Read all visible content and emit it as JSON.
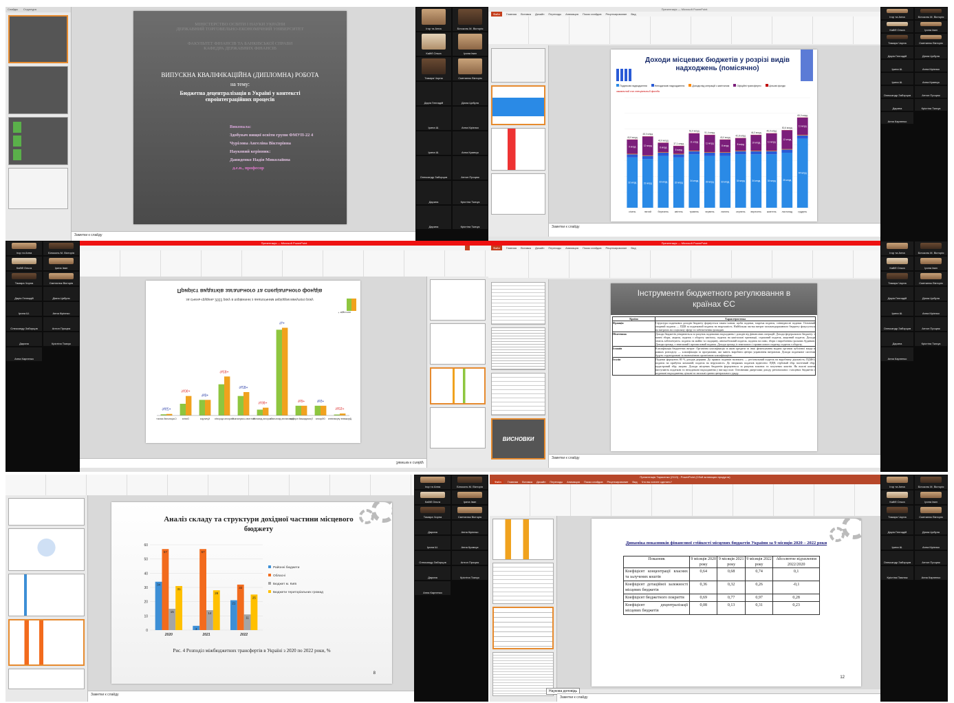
{
  "p1": {
    "tabs": [
      "Слайды",
      "Структура"
    ],
    "notes": "Заметки к слайду",
    "slide": {
      "ministry": "МІНІСТЕРСТВО ОСВІТИ І НАУКИ УКРАЇНИ",
      "univ": "ДЕРЖАВНИЙ ТОРГОВЕЛЬНО-ЕКОНОМІЧНИЙ УНІВЕРСИТЕТ",
      "faculty": "ФАКУЛЬТЕТ ФІНАНСІВ ТА БАНКІВСЬКОЇ СПРАВИ",
      "dept": "КАФЕДРА ДЕРЖАВНИХ ФІНАНСІВ",
      "work": "ВИПУСКНА КВАЛІФІКАЦІЙНА (ДИПЛОМНА) РОБОТА",
      "on_topic": "на тему:",
      "topic": "Бюджетна децентралізація в Україні у контексті євроінтеграційних процесів",
      "done_by": "Виконала:",
      "student_group": "Здобувач вищої освіти групи ФМУП-22 4",
      "student": "Чурілова Ангеліна Вікторівна",
      "supervisor_lbl": "Науковий керівник:",
      "supervisor": "Давиденко Надія Миколаївна",
      "degree": "д.е.н., професор"
    }
  },
  "g1": [
    "Ігор та Анна",
    "Білоконь М. Вікторія",
    "Кайіб Ольга",
    "Ірина Іван",
    "Тамара Чорна",
    "Сметанюк Вікторія",
    "Дарія Геннадій",
    "Діана Цибуля",
    "Ірина Ш.",
    "Анна Кірієнко",
    "Ірина Ш.",
    "Анна Кравчук",
    "Олександр Заборцов",
    "Антон Процюк",
    "Дарина",
    "Крістіна Ткачук",
    "Дарина",
    "Крістіна Ткачук"
  ],
  "p2": {
    "title": "Презентація — Microsoft PowerPoint",
    "tabs": [
      "Файл",
      "Главная",
      "Вставка",
      "Дизайн",
      "Переходы",
      "Анимация",
      "Показ слайдов",
      "Рецензирование",
      "Вид"
    ],
    "notes": "Заметки к слайду",
    "chart_data": {
      "type": "bar",
      "title": "Доходи місцевих бюджетів у розрізі видів надходжень (помісячно)",
      "categories": [
        "січень",
        "лютий",
        "березень",
        "квітень",
        "травень",
        "червень",
        "липень",
        "серпень",
        "вересень",
        "жовтень",
        "листопад",
        "грудень"
      ],
      "series": [
        {
          "name": "Податкові надходження",
          "values": [
            32,
            31,
            33,
            32,
            34,
            33,
            33,
            34,
            34,
            34,
            35,
            44
          ],
          "color": "#2a8ae6"
        },
        {
          "name": "Неподаткові надходження",
          "values": [
            2,
            2,
            2,
            2,
            2,
            2,
            2,
            2,
            2,
            2,
            2,
            2
          ],
          "color": "#2a5bd6"
        },
        {
          "name": "Доходи від операцій з капіталом",
          "values": [
            0.3,
            0.3,
            0.3,
            0.3,
            0.3,
            0.3,
            0.3,
            0.3,
            0.3,
            0.3,
            0.3,
            0.3
          ],
          "color": "#ff8a00"
        },
        {
          "name": "Офіційні трансферти",
          "values": [
            9,
            12,
            6,
            5,
            11,
            11,
            8,
            8,
            10,
            11,
            12,
            11
          ],
          "color": "#7b1e7a"
        },
        {
          "name": "Цільові фонди",
          "values": [
            0.1,
            0.1,
            0.1,
            0.1,
            0.1,
            0.1,
            0.1,
            0.1,
            0.1,
            0.1,
            0.1,
            0.1
          ],
          "color": "#c00000"
        }
      ],
      "totals": [
        "43,9 млрд",
        "48,0 млрд",
        "40,9 млрд",
        "37,1 млрд",
        "51,9 млрд",
        "51,4 млрд",
        "43,0 млрд",
        "42,8 млрд",
        "46,3 млрд",
        "46,9 млрд",
        "50,6 млрд",
        "65,0 млрд"
      ],
      "legend_extra": "загальний та спеціальний фонди",
      "ylim": [
        0,
        70
      ]
    }
  },
  "g2": [
    "Ігор та Анна",
    "Білоконь М. Вікторія",
    "Кайіб Ольга",
    "Ірина Іван",
    "Тамара Чорна",
    "Сметанюк Вікторія",
    "Дарія Геннадій",
    "Діана Цибуля",
    "Ірина Ш.",
    "Анна Кірієнко",
    "Ірина Ш.",
    "Анна Кравчук",
    "Олександр Заборцов",
    "Антон Процюк",
    "Дарина",
    "Крістіна Ткачук",
    "Анна Карпенко"
  ],
  "p3": {
    "title": "Презентація — Microsoft PowerPoint",
    "notes": "Заметки к слайду",
    "chart_data": {
      "type": "bar",
      "title": "Приріст видатків загального та спеціального фондів",
      "subtitle": "за січень-грудень 2022 року в порівнянні з аналогічним періодом минулого року",
      "categories": [
        "Державне управління",
        "Оборона",
        "Громадський порядок",
        "Економічна діяльність",
        "Охорона довкілля",
        "Житлово-комунальне",
        "Охорона здоров'я",
        "Культура",
        "Освіта",
        "Соціальний захист"
      ],
      "series": [
        {
          "name": "загальний фонд",
          "values": [
            1,
            5,
            5,
            45,
            4,
            12,
            20,
            8,
            10,
            0.8
          ],
          "color": "#f0a21e"
        },
        {
          "name": "спеціальний фонд",
          "values": [
            0.5,
            5,
            5,
            44,
            3,
            10,
            16,
            8,
            6,
            0.6
          ],
          "color": "#8ec63f"
        }
      ],
      "labels": [
        "+53%",
        "+5%",
        "+8%",
        "+%",
        "+86%",
        "+82%",
        "+83%",
        "+8%",
        "+90%",
        "+29%"
      ],
      "legend": "+ відсоток"
    }
  },
  "g3": [
    "Ігор та Анна",
    "Білоконь М. Вікторія",
    "Кайіб Ольга",
    "Ірина Іван",
    "Тамара Чорна",
    "Сметанюк Вікторія",
    "Дарія Геннадій",
    "Діана Цибуля",
    "Ірина Ш.",
    "Анна Кірієнко",
    "Олександр Заборцов",
    "Антон Процюк",
    "Дарина",
    "Крістіна Ткачук",
    "Анна Карпенко"
  ],
  "p4": {
    "title": "Презентація — Microsoft PowerPoint",
    "notes": "Заметки к слайду",
    "slide_title": "Інструменти бюджетного регулювання в країнах ЄС",
    "table": {
      "head": [
        "Країна",
        "Характеристика"
      ],
      "rows": [
        [
          "Франція",
          "Структура податкових доходів бюджету формується таким чином, щоби податки, зокрема податок, співвідносні податки. Основний опорний податок — ПДВ за податковий податок на нерухомість. Найбільша частка витрат загальнодержавного бюджету фокусується на витратах на соціальну сферу та забезпечення громадян."
        ],
        [
          "Німеччина",
          "Доходи бюджетів утворюються за рахунок податкових надходжень і доходів від фінансових операцій. Доходи федерального бюджету: з митні збори, акцизи, податок з обороту капіталу, податок на капітальні транзакції, страховий податок, акцизний податок. Доходи земель забезпечують: податок на майно та спадщину, автомобільний податок, податок на пиво, збори з вироблення гральних будинків. Доходи громад: з земельний і промисловий податок. Доходи громад із земельного і промислового податку, податок з обороту."
        ],
        [
          "Іспанія",
          "Класифікація бюджетних витрат: Органічна класифікація за якою кредити та інші фінансування видано органам публічної влади в рамках розподілу. — класифікація за програмами, які мають виробити центри управління витратами. Доходи податкової системи будуть структуровані за економічною органічною класифікацією."
        ],
        [
          "Італія",
          "Податки формують 80 % доходів держави. До прямих податків належать: — регіональний податок на виробничу діяльність; ПДФО; податок на прибуток компаній; податок на нерухомість. До непрямих податків віднесено: ПДВ; гербовий збір; іпотечний збір; кадастровий збір; акцизи. Доходи місцевих бюджетів формуються за рахунок власних та залучених коштів. Як власні кошти виступають податкові та неподаткові надходження у вигляді плат. Основними джерелами доходу регіональних і місцевих бюджетів є податкові надходження, цільові та загальні гранти центрального уряду."
        ]
      ]
    },
    "thumb_title": "ВИСНОВКИ"
  },
  "g4": [
    "Ігор та Анна",
    "Білоконь М. Вікторія",
    "Кайіб Ольга",
    "Ірина Іван",
    "Тамара Чорна",
    "Сметанюк Вікторія",
    "Дарія Геннадій",
    "Діана Цибуля",
    "Ірина Ш.",
    "Анна Кірієнко",
    "Олександр Заборцов",
    "Антон Процюк",
    "Дарина",
    "Крістіна Ткачук",
    "Анна Карпенко"
  ],
  "p5": {
    "notes": "Заметки к слайду",
    "slide_title": "Аналіз складу та структури дохідної частини місцевого бюджету",
    "caption": "Рис. 4 Розподіл міжбюджетних трансфертів в Україні з 2020 по 2022 роки, %",
    "page": "8",
    "chart_data": {
      "type": "bar",
      "categories": [
        "2020",
        "2021",
        "2022"
      ],
      "series": [
        {
          "name": "Районні бюджети",
          "values": [
            34,
            3,
            21
          ],
          "color": "#3d8fd6"
        },
        {
          "name": "Обласні",
          "values": [
            57,
            57,
            32
          ],
          "color": "#f26b1d"
        },
        {
          "name": "Бюджет м. Київ",
          "values": [
            15,
            14,
            11
          ],
          "color": "#a5a5a5"
        },
        {
          "name": "Бюджети територіальних громад",
          "values": [
            31,
            28,
            25
          ],
          "color": "#ffc000"
        }
      ],
      "ylim": [
        0,
        60
      ],
      "yticks": [
        0,
        10,
        20,
        30,
        40,
        50,
        60
      ]
    }
  },
  "g5": [
    "Ігор та Анна",
    "Білоконь М. Вікторія",
    "Кайіб Ольга",
    "Ірина Іван",
    "Тамара Чорна",
    "Сметанюк Вікторія",
    "Дарина",
    "Анна Кірієнко",
    "Ірина Ш.",
    "Анна Кравчук",
    "Олександр Заборцов",
    "Антон Процюк",
    "Дарина",
    "Крістіна Ткачук",
    "Анна Карпенко"
  ],
  "p6": {
    "title": "Презентація Тарасенко (2113) - PowerPoint (Сбой активации продукта)",
    "tabs": [
      "Файл",
      "Главная",
      "Вставка",
      "Дизайн",
      "Переходы",
      "Анимация",
      "Показ слайдов",
      "Рецензирование",
      "Вид",
      "Что вы хотите сделать?"
    ],
    "notes": "Заметки к слайду",
    "slide_title": "Динаміка показників фінансової стійкості місцевих бюджетів України за 9 місяців 2020 – 2022 роки",
    "page": "12",
    "table": {
      "head": [
        "Показник",
        "9 місяців 2020 року",
        "9 місяців 2021 року",
        "9 місяців 2022 року",
        "Абсолютне відхилення 2022/2020"
      ],
      "rows": [
        [
          "Коефіцієнт концентрації власних та залучених коштів",
          "0,64",
          "0,68",
          "0,74",
          "0,1"
        ],
        [
          "Коефіцієнт дотаційної залежності місцевих бюджетів",
          "0,36",
          "0,32",
          "0,26",
          "-0,1"
        ],
        [
          "Коефіцієнт бюджетного покриття",
          "0,69",
          "0,77",
          "0,97",
          "0,28"
        ],
        [
          "Коефіцієнт децентралізації місцевих бюджетів",
          "0,08",
          "0,13",
          "0,31",
          "0,23"
        ]
      ]
    },
    "tooltip": "Наукова доповідь"
  },
  "g6": [
    "Ігор та Анна",
    "Білоконь М. Вікторія",
    "Кайіб Ольга",
    "Ірина Іван",
    "Тамара Чорна",
    "Сметанюк Вікторія",
    "Дарія Геннадій",
    "Діана Цибуля",
    "Ірина Ш.",
    "Анна Кірієнко",
    "Олександр Заборцов",
    "Антон Процюк",
    "Крістіна Павлюк",
    "Анна Карпенко"
  ]
}
